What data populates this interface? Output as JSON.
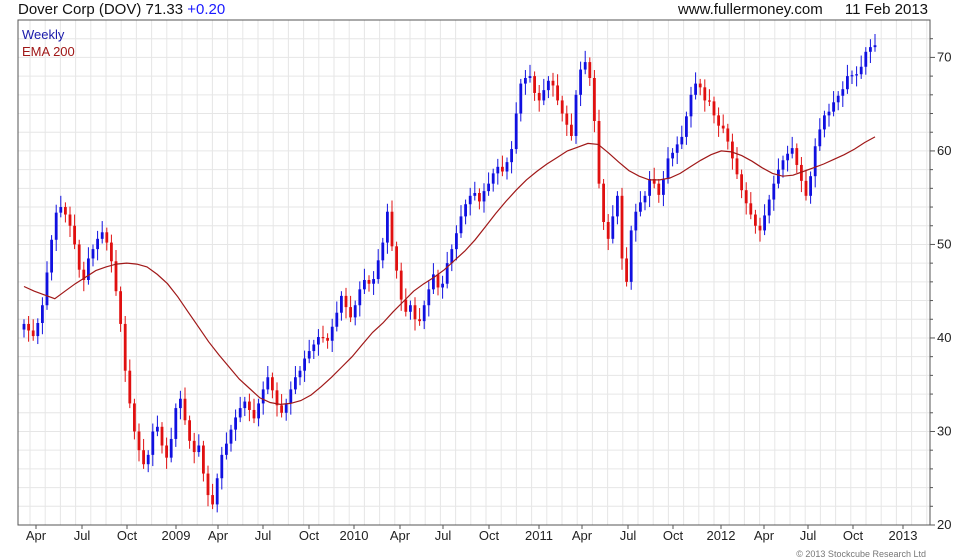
{
  "header": {
    "title": "Dover Corp (DOV) 71.33",
    "change": "+0.20",
    "website": "www.fullermoney.com",
    "date": "11 Feb 2013"
  },
  "copyright": "© 2013 Stockcube Research Ltd",
  "colors": {
    "up": "#1010e0",
    "down": "#e01010",
    "ema": "#a01818",
    "grid": "#e6e6e6",
    "axis": "#555555"
  },
  "chart_data": {
    "type": "candlestick",
    "legend": [
      {
        "label": "Weekly",
        "color": "#1a1aaa"
      },
      {
        "label": "EMA 200",
        "color": "#a01818"
      }
    ],
    "ylim": [
      20,
      74
    ],
    "y_ticks": [
      20,
      30,
      40,
      50,
      60,
      70
    ],
    "x_ticks": [
      "Apr",
      "Jul",
      "Oct",
      "2009",
      "Apr",
      "Jul",
      "Oct",
      "2010",
      "Apr",
      "Jul",
      "Oct",
      "2011",
      "Apr",
      "Jul",
      "Oct",
      "2012",
      "Apr",
      "Jul",
      "Oct",
      "2013"
    ],
    "grid": true,
    "weekly_close": [
      41.5,
      40.8,
      40.2,
      41.6,
      43.5,
      47.0,
      50.5,
      53.4,
      54.0,
      53.2,
      52.0,
      50.0,
      47.3,
      46.2,
      48.5,
      49.5,
      50.6,
      51.3,
      50.2,
      48.2,
      45.0,
      41.5,
      36.5,
      33.0,
      30.0,
      28.0,
      26.5,
      27.5,
      30.0,
      30.5,
      28.5,
      27.2,
      29.2,
      32.5,
      33.5,
      31.2,
      29.0,
      27.8,
      28.5,
      25.5,
      23.2,
      22.2,
      25.0,
      27.5,
      28.7,
      30.2,
      31.5,
      32.5,
      33.2,
      32.3,
      31.4,
      33.0,
      34.5,
      35.8,
      34.4,
      32.8,
      32.0,
      33.0,
      34.5,
      35.8,
      36.5,
      37.8,
      38.6,
      39.3,
      40.1,
      40.0,
      39.7,
      41.2,
      42.7,
      44.5,
      43.3,
      42.2,
      43.5,
      45.2,
      46.2,
      45.8,
      46.3,
      48.3,
      50.2,
      53.5,
      49.8,
      47.2,
      44.1,
      42.8,
      43.5,
      42.0,
      41.8,
      43.5,
      45.2,
      46.8,
      45.4,
      45.8,
      48.0,
      49.5,
      51.2,
      53.0,
      54.3,
      55.2,
      55.5,
      54.6,
      55.7,
      56.5,
      57.6,
      58.3,
      57.8,
      58.8,
      60.2,
      64.0,
      67.2,
      67.8,
      68.0,
      66.2,
      65.4,
      66.5,
      67.5,
      67.0,
      65.4,
      64.0,
      62.8,
      61.6,
      66.0,
      68.7,
      69.5,
      67.8,
      63.2,
      56.5,
      52.4,
      50.6,
      53.0,
      55.2,
      48.5,
      46.0,
      51.5,
      53.5,
      54.5,
      55.2,
      57.0,
      56.5,
      55.3,
      57.0,
      59.2,
      59.8,
      60.7,
      61.5,
      63.7,
      66.0,
      67.2,
      66.8,
      65.4,
      65.3,
      63.8,
      62.7,
      62.4,
      61.0,
      59.2,
      57.5,
      55.8,
      54.4,
      53.2,
      52.0,
      51.5,
      53.1,
      54.8,
      56.5,
      58.0,
      59.0,
      59.7,
      60.3,
      58.5,
      56.8,
      55.2,
      57.3,
      60.5,
      62.3,
      63.8,
      64.2,
      65.2,
      65.9,
      66.6,
      68.0,
      68.1,
      68.2,
      69.0,
      70.6,
      71.1,
      71.3
    ],
    "ema_200": [
      45.5,
      45.0,
      44.6,
      44.2,
      45.0,
      45.8,
      46.5,
      47.2,
      47.6,
      47.9,
      48.0,
      47.9,
      47.6,
      46.8,
      45.8,
      44.4,
      42.8,
      41.2,
      39.6,
      38.2,
      36.9,
      35.6,
      34.6,
      33.6,
      33.1,
      32.9,
      33.0,
      33.3,
      33.9,
      34.8,
      35.8,
      36.9,
      38.0,
      39.3,
      40.6,
      41.6,
      42.8,
      43.9,
      45.0,
      45.8,
      46.5,
      47.3,
      48.3,
      49.3,
      50.5,
      51.9,
      53.3,
      54.6,
      55.8,
      56.9,
      57.8,
      58.6,
      59.3,
      60.0,
      60.4,
      60.8,
      60.7,
      59.8,
      58.8,
      57.9,
      57.3,
      56.9,
      56.9,
      57.1,
      57.6,
      58.3,
      59.0,
      59.6,
      60.0,
      59.9,
      59.5,
      58.9,
      58.2,
      57.6,
      57.3,
      57.4,
      57.8,
      58.2,
      58.6,
      59.1,
      59.6,
      60.2,
      60.9,
      61.5
    ],
    "ema_200_tags": [
      "Apr 2008",
      "Jul",
      "Oct",
      "2009",
      "Apr",
      "Jul",
      "Oct",
      "2010",
      "Apr",
      "Jul",
      "Oct",
      "2011",
      "Apr",
      "Jul",
      "Oct",
      "2012",
      "Apr",
      "Jul",
      "Oct",
      "2013"
    ]
  }
}
